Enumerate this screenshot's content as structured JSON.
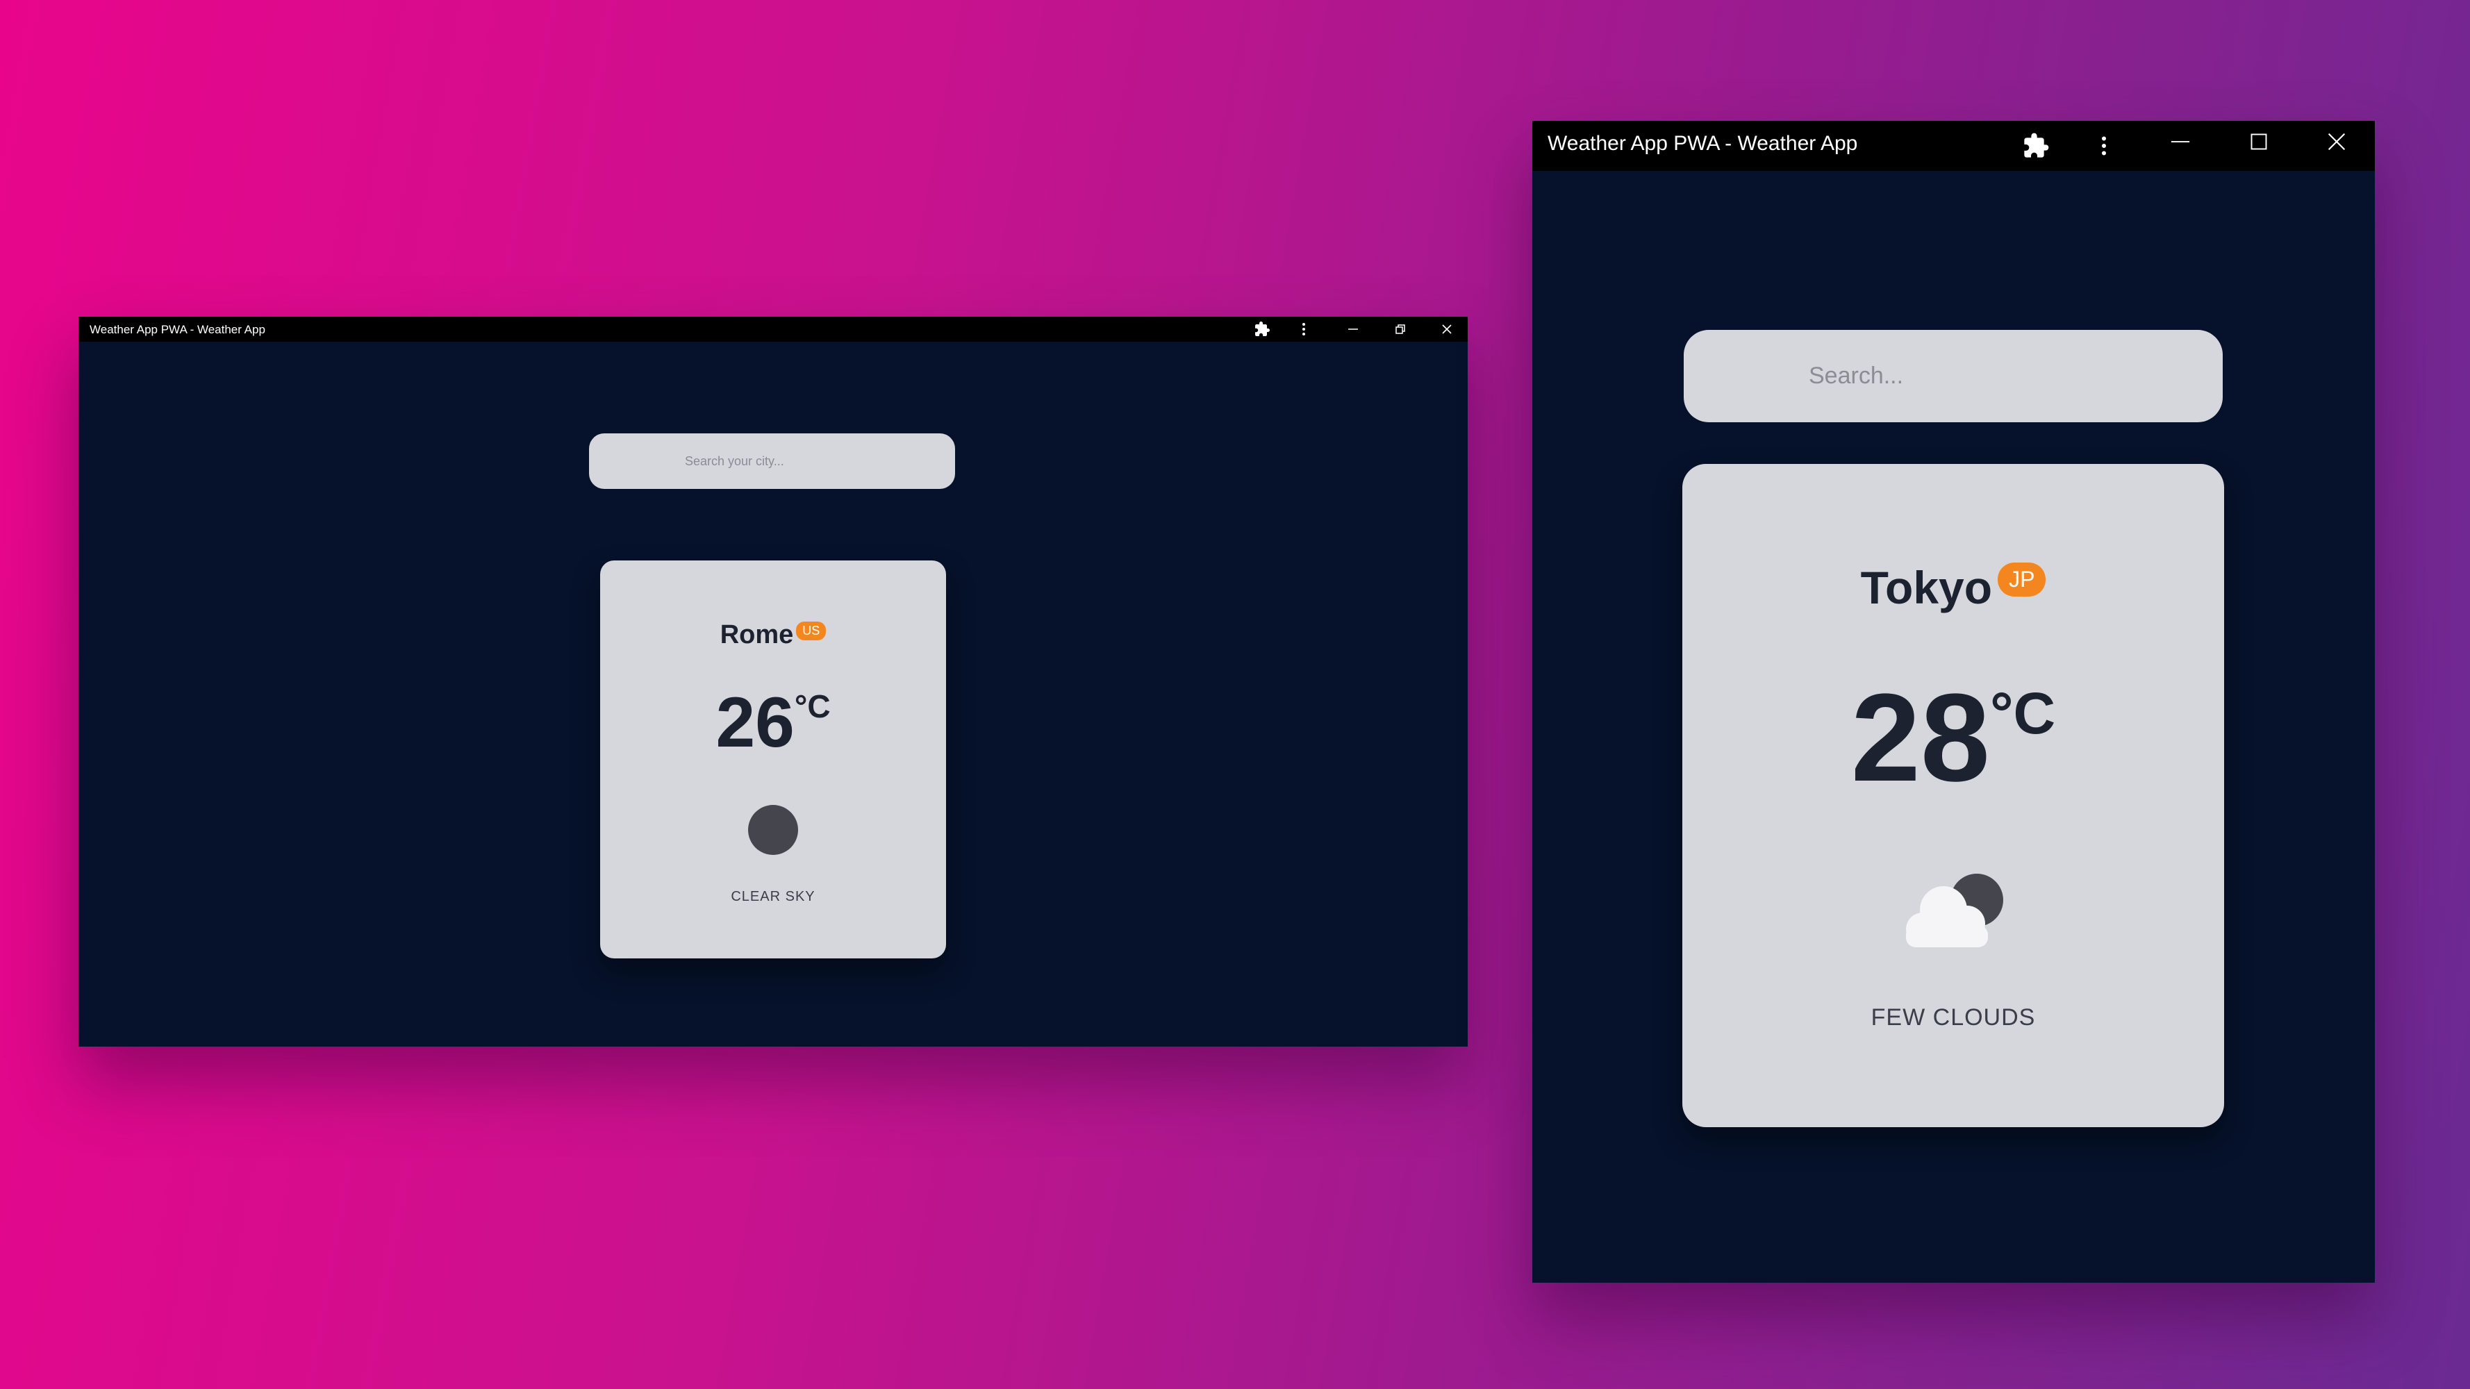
{
  "colors": {
    "window_bg": "#06122b",
    "card_bg": "#d6d7dc",
    "badge": "#f4861f",
    "text_dark": "#1d2230",
    "titlebar": "#000000"
  },
  "left_window": {
    "title": "Weather App PWA - Weather App",
    "toolbar_icons": [
      "extensions-icon",
      "more-vert-icon",
      "minimize-icon",
      "restore-icon",
      "close-icon"
    ],
    "search": {
      "value": "",
      "placeholder": "Search your city..."
    },
    "weather": {
      "city": "Rome",
      "country": "US",
      "temperature": "26",
      "unit": "°C",
      "icon": "clear-sky-icon",
      "description": "CLEAR SKY"
    }
  },
  "right_window": {
    "title": "Weather App PWA - Weather App",
    "toolbar_icons": [
      "extensions-icon",
      "more-vert-icon",
      "minimize-icon",
      "maximize-icon",
      "close-icon"
    ],
    "search": {
      "value": "",
      "placeholder": "Search..."
    },
    "weather": {
      "city": "Tokyo",
      "country": "JP",
      "temperature": "28",
      "unit": "°C",
      "icon": "few-clouds-icon",
      "description": "FEW CLOUDS"
    }
  }
}
